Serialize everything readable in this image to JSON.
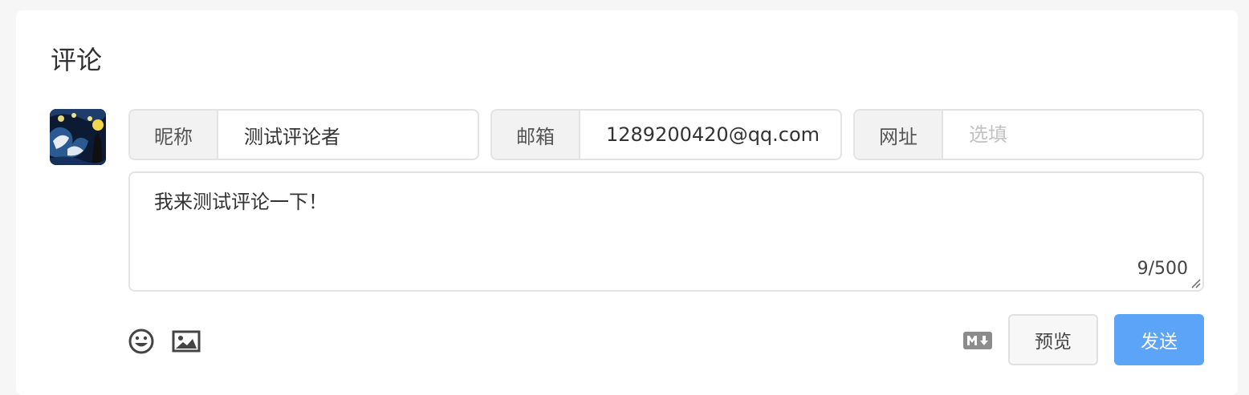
{
  "section_title": "评论",
  "form": {
    "nickname": {
      "label": "昵称",
      "value": "测试评论者",
      "placeholder": ""
    },
    "email": {
      "label": "邮箱",
      "value": "1289200420@qq.com",
      "placeholder": ""
    },
    "website": {
      "label": "网址",
      "value": "",
      "placeholder": "选填"
    },
    "comment": {
      "value": "我来测试评论一下！",
      "counter": "9/500"
    }
  },
  "toolbar": {
    "icons": [
      "emoji-icon",
      "image-icon",
      "markdown-icon"
    ],
    "preview_label": "预览",
    "send_label": "发送"
  },
  "colors": {
    "accent": "#5ba4f7",
    "border": "#e3e3e3",
    "label_bg": "#f2f2f2"
  }
}
